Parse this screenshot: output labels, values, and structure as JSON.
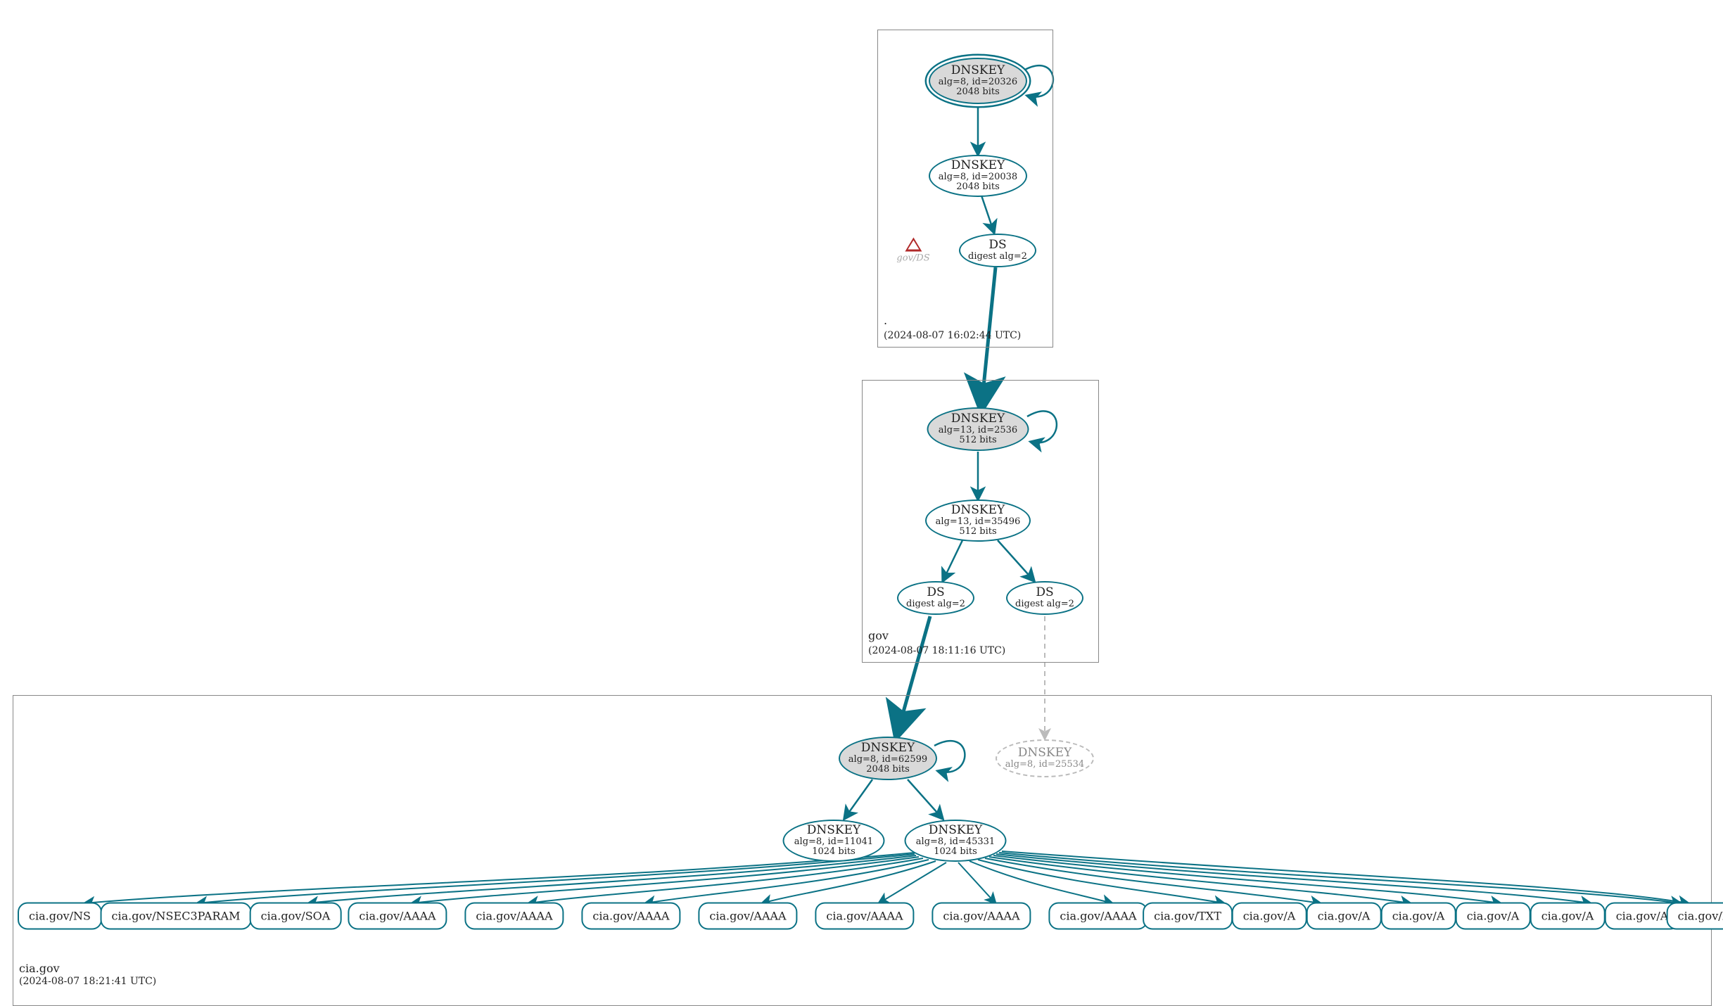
{
  "colors": {
    "edge": "#0b7285",
    "edge_dashed": "#bbbbbb",
    "zone_border": "#888888"
  },
  "zone_root": {
    "label": ".",
    "timestamp": "(2024-08-07 16:02:44 UTC)"
  },
  "zone_gov": {
    "label": "gov",
    "timestamp": "(2024-08-07 18:11:16 UTC)"
  },
  "zone_cia": {
    "label": "cia.gov",
    "timestamp": "(2024-08-07 18:21:41 UTC)"
  },
  "warn_root": {
    "label": "gov/DS"
  },
  "root_ksk": {
    "title": "DNSKEY",
    "sub1": "alg=8, id=20326",
    "sub2": "2048 bits"
  },
  "root_zsk": {
    "title": "DNSKEY",
    "sub1": "alg=8, id=20038",
    "sub2": "2048 bits"
  },
  "root_ds": {
    "title": "DS",
    "sub1": "digest alg=2",
    "sub2": ""
  },
  "gov_ksk": {
    "title": "DNSKEY",
    "sub1": "alg=13, id=2536",
    "sub2": "512 bits"
  },
  "gov_zsk": {
    "title": "DNSKEY",
    "sub1": "alg=13, id=35496",
    "sub2": "512 bits"
  },
  "gov_ds1": {
    "title": "DS",
    "sub1": "digest alg=2",
    "sub2": ""
  },
  "gov_ds2": {
    "title": "DS",
    "sub1": "digest alg=2",
    "sub2": ""
  },
  "cia_ksk": {
    "title": "DNSKEY",
    "sub1": "alg=8, id=62599",
    "sub2": "2048 bits"
  },
  "cia_missing": {
    "title": "DNSKEY",
    "sub1": "alg=8, id=25534",
    "sub2": ""
  },
  "cia_zsk1": {
    "title": "DNSKEY",
    "sub1": "alg=8, id=11041",
    "sub2": "1024 bits"
  },
  "cia_zsk2": {
    "title": "DNSKEY",
    "sub1": "alg=8, id=45331",
    "sub2": "1024 bits"
  },
  "rr": {
    "ns": "cia.gov/NS",
    "nsec3": "cia.gov/NSEC3PARAM",
    "soa": "cia.gov/SOA",
    "aaaa1": "cia.gov/AAAA",
    "aaaa2": "cia.gov/AAAA",
    "aaaa3": "cia.gov/AAAA",
    "aaaa4": "cia.gov/AAAA",
    "aaaa5": "cia.gov/AAAA",
    "aaaa6": "cia.gov/AAAA",
    "aaaa7": "cia.gov/AAAA",
    "txt": "cia.gov/TXT",
    "a1": "cia.gov/A",
    "a2": "cia.gov/A",
    "a3": "cia.gov/A",
    "a4": "cia.gov/A",
    "a5": "cia.gov/A",
    "a6": "cia.gov/A",
    "mx": "cia.gov/MX"
  },
  "chart_data": {
    "type": "tree",
    "zones": [
      {
        "name": ".",
        "timestamp": "2024-08-07 16:02:44 UTC"
      },
      {
        "name": "gov",
        "timestamp": "2024-08-07 18:11:16 UTC"
      },
      {
        "name": "cia.gov",
        "timestamp": "2024-08-07 18:21:41 UTC"
      }
    ],
    "nodes": [
      {
        "id": "root_ksk",
        "zone": ".",
        "type": "DNSKEY",
        "alg": 8,
        "key_id": 20326,
        "bits": 2048,
        "role": "KSK",
        "secure_entry_point": true
      },
      {
        "id": "root_zsk",
        "zone": ".",
        "type": "DNSKEY",
        "alg": 8,
        "key_id": 20038,
        "bits": 2048,
        "role": "ZSK"
      },
      {
        "id": "root_ds",
        "zone": ".",
        "type": "DS",
        "digest_alg": 2
      },
      {
        "id": "root_warn",
        "zone": ".",
        "type": "warning",
        "label": "gov/DS"
      },
      {
        "id": "gov_ksk",
        "zone": "gov",
        "type": "DNSKEY",
        "alg": 13,
        "key_id": 2536,
        "bits": 512,
        "role": "KSK"
      },
      {
        "id": "gov_zsk",
        "zone": "gov",
        "type": "DNSKEY",
        "alg": 13,
        "key_id": 35496,
        "bits": 512,
        "role": "ZSK"
      },
      {
        "id": "gov_ds1",
        "zone": "gov",
        "type": "DS",
        "digest_alg": 2
      },
      {
        "id": "gov_ds2",
        "zone": "gov",
        "type": "DS",
        "digest_alg": 2
      },
      {
        "id": "cia_ksk",
        "zone": "cia.gov",
        "type": "DNSKEY",
        "alg": 8,
        "key_id": 62599,
        "bits": 2048,
        "role": "KSK"
      },
      {
        "id": "cia_missing",
        "zone": "cia.gov",
        "type": "DNSKEY",
        "alg": 8,
        "key_id": 25534,
        "status": "absent"
      },
      {
        "id": "cia_zsk1",
        "zone": "cia.gov",
        "type": "DNSKEY",
        "alg": 8,
        "key_id": 11041,
        "bits": 1024,
        "role": "ZSK"
      },
      {
        "id": "cia_zsk2",
        "zone": "cia.gov",
        "type": "DNSKEY",
        "alg": 8,
        "key_id": 45331,
        "bits": 1024,
        "role": "ZSK"
      },
      {
        "id": "rr_ns",
        "zone": "cia.gov",
        "type": "RRset",
        "name": "cia.gov",
        "rrtype": "NS"
      },
      {
        "id": "rr_nsec3",
        "zone": "cia.gov",
        "type": "RRset",
        "name": "cia.gov",
        "rrtype": "NSEC3PARAM"
      },
      {
        "id": "rr_soa",
        "zone": "cia.gov",
        "type": "RRset",
        "name": "cia.gov",
        "rrtype": "SOA"
      },
      {
        "id": "rr_aaaa1",
        "zone": "cia.gov",
        "type": "RRset",
        "name": "cia.gov",
        "rrtype": "AAAA"
      },
      {
        "id": "rr_aaaa2",
        "zone": "cia.gov",
        "type": "RRset",
        "name": "cia.gov",
        "rrtype": "AAAA"
      },
      {
        "id": "rr_aaaa3",
        "zone": "cia.gov",
        "type": "RRset",
        "name": "cia.gov",
        "rrtype": "AAAA"
      },
      {
        "id": "rr_aaaa4",
        "zone": "cia.gov",
        "type": "RRset",
        "name": "cia.gov",
        "rrtype": "AAAA"
      },
      {
        "id": "rr_aaaa5",
        "zone": "cia.gov",
        "type": "RRset",
        "name": "cia.gov",
        "rrtype": "AAAA"
      },
      {
        "id": "rr_aaaa6",
        "zone": "cia.gov",
        "type": "RRset",
        "name": "cia.gov",
        "rrtype": "AAAA"
      },
      {
        "id": "rr_aaaa7",
        "zone": "cia.gov",
        "type": "RRset",
        "name": "cia.gov",
        "rrtype": "AAAA"
      },
      {
        "id": "rr_txt",
        "zone": "cia.gov",
        "type": "RRset",
        "name": "cia.gov",
        "rrtype": "TXT"
      },
      {
        "id": "rr_a1",
        "zone": "cia.gov",
        "type": "RRset",
        "name": "cia.gov",
        "rrtype": "A"
      },
      {
        "id": "rr_a2",
        "zone": "cia.gov",
        "type": "RRset",
        "name": "cia.gov",
        "rrtype": "A"
      },
      {
        "id": "rr_a3",
        "zone": "cia.gov",
        "type": "RRset",
        "name": "cia.gov",
        "rrtype": "A"
      },
      {
        "id": "rr_a4",
        "zone": "cia.gov",
        "type": "RRset",
        "name": "cia.gov",
        "rrtype": "A"
      },
      {
        "id": "rr_a5",
        "zone": "cia.gov",
        "type": "RRset",
        "name": "cia.gov",
        "rrtype": "A"
      },
      {
        "id": "rr_a6",
        "zone": "cia.gov",
        "type": "RRset",
        "name": "cia.gov",
        "rrtype": "A"
      },
      {
        "id": "rr_mx",
        "zone": "cia.gov",
        "type": "RRset",
        "name": "cia.gov",
        "rrtype": "MX"
      }
    ],
    "edges": [
      {
        "from": "root_ksk",
        "to": "root_ksk",
        "style": "self"
      },
      {
        "from": "root_ksk",
        "to": "root_zsk"
      },
      {
        "from": "root_zsk",
        "to": "root_ds"
      },
      {
        "from": "root_ds",
        "to": "gov_ksk",
        "style": "bold"
      },
      {
        "from": "gov_ksk",
        "to": "gov_ksk",
        "style": "self"
      },
      {
        "from": "gov_ksk",
        "to": "gov_zsk"
      },
      {
        "from": "gov_zsk",
        "to": "gov_ds1"
      },
      {
        "from": "gov_zsk",
        "to": "gov_ds2"
      },
      {
        "from": "gov_ds1",
        "to": "cia_ksk",
        "style": "bold"
      },
      {
        "from": "gov_ds2",
        "to": "cia_missing",
        "style": "dashed"
      },
      {
        "from": "cia_ksk",
        "to": "cia_ksk",
        "style": "self"
      },
      {
        "from": "cia_ksk",
        "to": "cia_zsk1"
      },
      {
        "from": "cia_ksk",
        "to": "cia_zsk2"
      },
      {
        "from": "cia_zsk2",
        "to": "rr_ns"
      },
      {
        "from": "cia_zsk2",
        "to": "rr_nsec3"
      },
      {
        "from": "cia_zsk2",
        "to": "rr_soa"
      },
      {
        "from": "cia_zsk2",
        "to": "rr_aaaa1"
      },
      {
        "from": "cia_zsk2",
        "to": "rr_aaaa2"
      },
      {
        "from": "cia_zsk2",
        "to": "rr_aaaa3"
      },
      {
        "from": "cia_zsk2",
        "to": "rr_aaaa4"
      },
      {
        "from": "cia_zsk2",
        "to": "rr_aaaa5"
      },
      {
        "from": "cia_zsk2",
        "to": "rr_aaaa6"
      },
      {
        "from": "cia_zsk2",
        "to": "rr_aaaa7"
      },
      {
        "from": "cia_zsk2",
        "to": "rr_txt"
      },
      {
        "from": "cia_zsk2",
        "to": "rr_a1"
      },
      {
        "from": "cia_zsk2",
        "to": "rr_a2"
      },
      {
        "from": "cia_zsk2",
        "to": "rr_a3"
      },
      {
        "from": "cia_zsk2",
        "to": "rr_a4"
      },
      {
        "from": "cia_zsk2",
        "to": "rr_a5"
      },
      {
        "from": "cia_zsk2",
        "to": "rr_a6"
      },
      {
        "from": "cia_zsk2",
        "to": "rr_mx"
      }
    ]
  }
}
